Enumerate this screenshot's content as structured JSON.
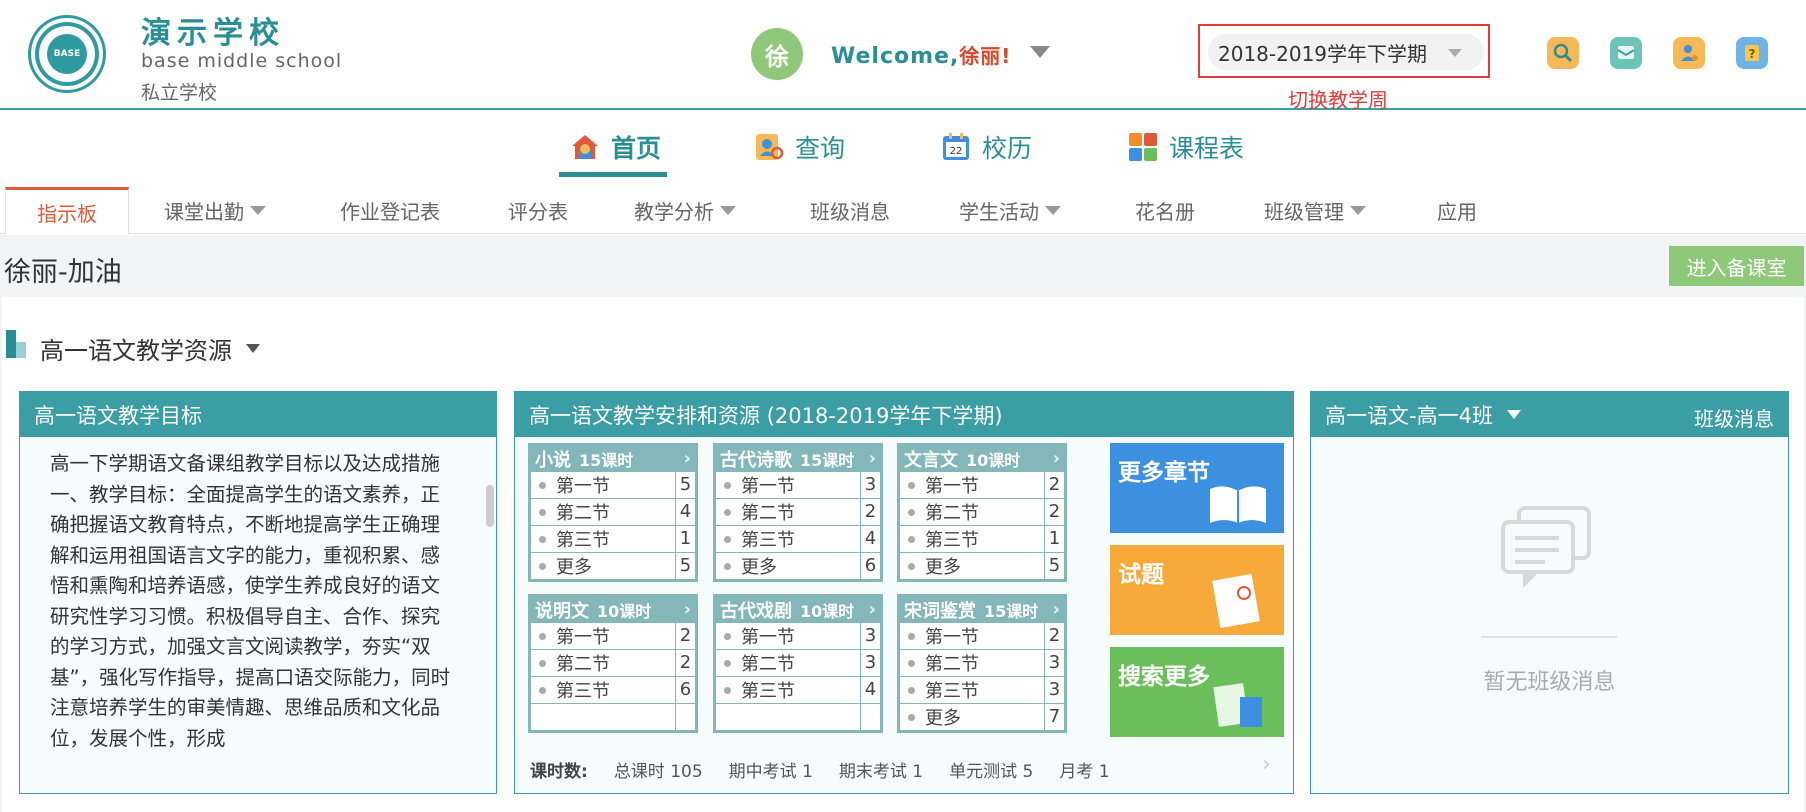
{
  "header": {
    "school_name": "演示学校",
    "school_en": "base middle school",
    "school_type": "私立学校",
    "logo_text": "BASE",
    "avatar_char": "徐",
    "welcome_prefix": "Welcome,",
    "user_name": "徐丽!",
    "term": "2018-2019学年下学期",
    "term_hint": "切换教学周"
  },
  "main_nav": [
    {
      "label": "首页",
      "icon": "home-icon"
    },
    {
      "label": "查询",
      "icon": "search-person-icon"
    },
    {
      "label": "校历",
      "icon": "calendar-icon"
    },
    {
      "label": "课程表",
      "icon": "schedule-icon"
    }
  ],
  "sub_tabs": [
    {
      "label": "指示板"
    },
    {
      "label": "课堂出勤"
    },
    {
      "label": "作业登记表"
    },
    {
      "label": "评分表"
    },
    {
      "label": "教学分析"
    },
    {
      "label": "班级消息"
    },
    {
      "label": "学生活动"
    },
    {
      "label": "花名册"
    },
    {
      "label": "班级管理"
    },
    {
      "label": "应用"
    }
  ],
  "greeting": "徐丽-加油",
  "enter_button": "进入备课室",
  "resource_title": "高一语文教学资源",
  "goals_card": {
    "title": "高一语文教学目标",
    "text": "高一下学期语文备课组教学目标以及达成措施\n一、教学目标：全面提高学生的语文素养，正确把握语文教育特点，不断地提高学生正确理解和运用祖国语言文字的能力，重视积累、感悟和熏陶和培养语感，使学生养成良好的语文研究性学习习惯。积极倡导自主、合作、探究的学习方式，加强文言文阅读教学，夯实“双基”，强化写作指导，提高口语交际能力，同时注意培养学生的审美情趣、思维品质和文化品位，发展个性，形成"
  },
  "plan_card": {
    "title": "高一语文教学安排和资源    (2018-2019学年下学期)",
    "units": [
      {
        "name": "小说",
        "hours": "15课时",
        "rows": [
          {
            "n": "第一节",
            "c": "5"
          },
          {
            "n": "第二节",
            "c": "4"
          },
          {
            "n": "第三节",
            "c": "1"
          },
          {
            "n": "更多",
            "c": "5"
          }
        ]
      },
      {
        "name": "古代诗歌",
        "hours": "15课时",
        "rows": [
          {
            "n": "第一节",
            "c": "3"
          },
          {
            "n": "第二节",
            "c": "2"
          },
          {
            "n": "第三节",
            "c": "4"
          },
          {
            "n": "更多",
            "c": "6"
          }
        ]
      },
      {
        "name": "文言文",
        "hours": "10课时",
        "rows": [
          {
            "n": "第一节",
            "c": "2"
          },
          {
            "n": "第二节",
            "c": "2"
          },
          {
            "n": "第三节",
            "c": "1"
          },
          {
            "n": "更多",
            "c": "5"
          }
        ]
      },
      {
        "name": "说明文",
        "hours": "10课时",
        "rows": [
          {
            "n": "第一节",
            "c": "2"
          },
          {
            "n": "第二节",
            "c": "2"
          },
          {
            "n": "第三节",
            "c": "6"
          },
          {
            "n": "",
            "c": ""
          }
        ]
      },
      {
        "name": "古代戏剧",
        "hours": "10课时",
        "rows": [
          {
            "n": "第一节",
            "c": "3"
          },
          {
            "n": "第二节",
            "c": "3"
          },
          {
            "n": "第三节",
            "c": "4"
          },
          {
            "n": "",
            "c": ""
          }
        ]
      },
      {
        "name": "宋词鉴赏",
        "hours": "15课时",
        "rows": [
          {
            "n": "第一节",
            "c": "2"
          },
          {
            "n": "第二节",
            "c": "3"
          },
          {
            "n": "第三节",
            "c": "3"
          },
          {
            "n": "更多",
            "c": "7"
          }
        ]
      }
    ],
    "tiles": [
      {
        "label": "更多章节",
        "color": "#3d8fe0"
      },
      {
        "label": "试题",
        "color": "#f7a93a"
      },
      {
        "label": "搜索更多",
        "color": "#6bbf5a"
      }
    ],
    "stats_label": "课时数:",
    "stats": [
      "总课时 105",
      "期中考试 1",
      "期末考试 1",
      "单元测试 5",
      "月考 1"
    ]
  },
  "class_card": {
    "title": "高一语文-高一4班",
    "link": "班级消息",
    "empty": "暂无班级消息"
  }
}
